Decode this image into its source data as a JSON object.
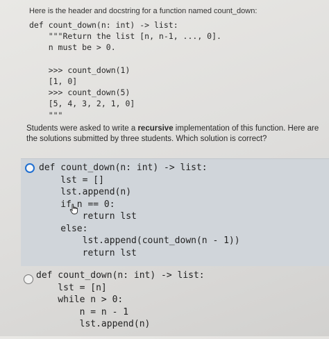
{
  "intro": "Here is the header and docstring for a function named count_down:",
  "header_code": "def count_down(n: int) -> list:\n    \"\"\"Return the list [n, n-1, ..., 0].\n    n must be > 0.\n\n    >>> count_down(1)\n    [1, 0]\n    >>> count_down(5)\n    [5, 4, 3, 2, 1, 0]\n    \"\"\"",
  "question": {
    "before": "Students were asked to write a ",
    "bold": "recursive",
    "after": " implementation of this function. Here are the solutions submitted by three students. Which solution is correct?"
  },
  "options": [
    {
      "code": "def count_down(n: int) -> list:\n    lst = []\n    lst.append(n)\n    if n == 0:\n        return lst\n    else:\n        lst.append(count_down(n - 1))\n        return lst"
    },
    {
      "code": "def count_down(n: int) -> list:\n    lst = [n]\n    while n > 0:\n        n = n - 1\n        lst.append(n)"
    }
  ],
  "colors": {
    "selected_radio": "#1f6fd1",
    "selected_bg": "#d0d5da"
  },
  "icons": {
    "pointer": "hand-pointer-icon"
  }
}
